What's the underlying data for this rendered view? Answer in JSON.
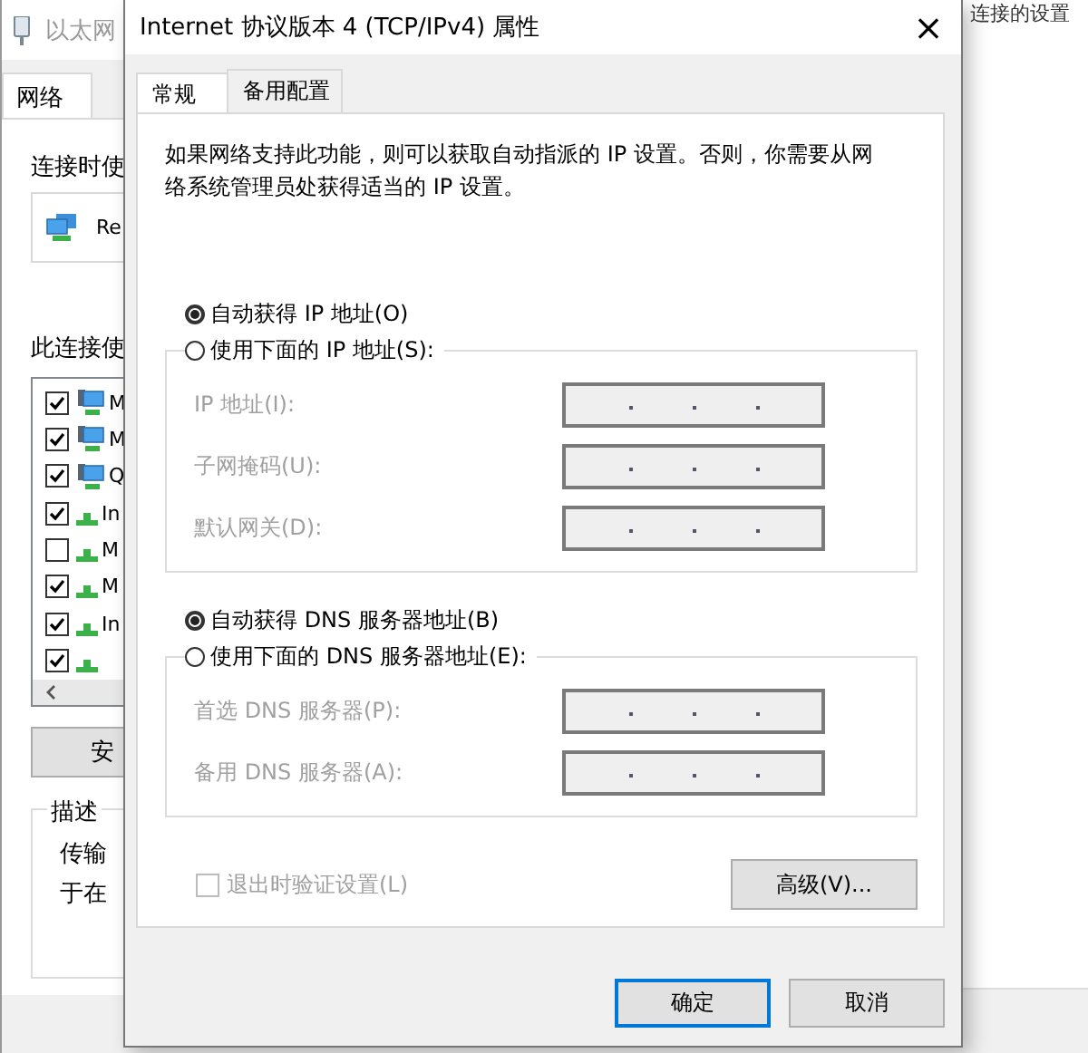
{
  "far_window": {
    "text": "连接的设置"
  },
  "back_window": {
    "title": "以太网",
    "tabs": [
      {
        "label": "网络",
        "selected": true
      }
    ],
    "connect_using_label": "连接时使",
    "adapter": "Re",
    "components_label": "此连接使",
    "components": [
      {
        "kind": "computer",
        "name": "M",
        "checked": true
      },
      {
        "kind": "computer",
        "name": "M",
        "checked": true
      },
      {
        "kind": "computer",
        "name": "Q",
        "checked": true
      },
      {
        "kind": "protocol",
        "name": "In",
        "checked": true
      },
      {
        "kind": "protocol",
        "name": "M",
        "checked": false
      },
      {
        "kind": "protocol",
        "name": "M",
        "checked": true
      },
      {
        "kind": "protocol",
        "name": "In",
        "checked": true
      },
      {
        "kind": "protocol",
        "checked": true
      }
    ],
    "install_button": "安",
    "description": {
      "title": "描述",
      "lines": [
        "传输",
        "于在"
      ]
    }
  },
  "dialog": {
    "title": "Internet 协议版本 4 (TCP/IPv4) 属性",
    "close": "×",
    "tabs": [
      {
        "label": "常规",
        "selected": true
      },
      {
        "label": "备用配置",
        "selected": false
      }
    ],
    "intro": "如果网络支持此功能，则可以获取自动指派的 IP 设置。否则，你需要从网络系统管理员处获得适当的 IP 设置。",
    "ip_options": [
      {
        "label": "自动获得 IP 地址(O)",
        "selected": true
      },
      {
        "label": "使用下面的 IP 地址(S):",
        "selected": false
      }
    ],
    "ip_fields": [
      {
        "label": "IP 地址(I):",
        "disabled": true
      },
      {
        "label": "子网掩码(U):",
        "disabled": true
      },
      {
        "label": "默认网关(D):",
        "disabled": true
      }
    ],
    "dns_options": [
      {
        "label": "自动获得 DNS 服务器地址(B)",
        "selected": true
      },
      {
        "label": "使用下面的 DNS 服务器地址(E):",
        "selected": false
      }
    ],
    "dns_fields": [
      {
        "label": "首选 DNS 服务器(P):",
        "disabled": true
      },
      {
        "label": "备用 DNS 服务器(A):",
        "disabled": true
      }
    ],
    "validate_checkbox": {
      "label": "退出时验证设置(L)",
      "checked": false,
      "disabled": true
    },
    "advanced_button": "高级(V)...",
    "buttons": [
      {
        "label": "确定",
        "default": true
      },
      {
        "label": "取消",
        "default": false
      }
    ]
  }
}
